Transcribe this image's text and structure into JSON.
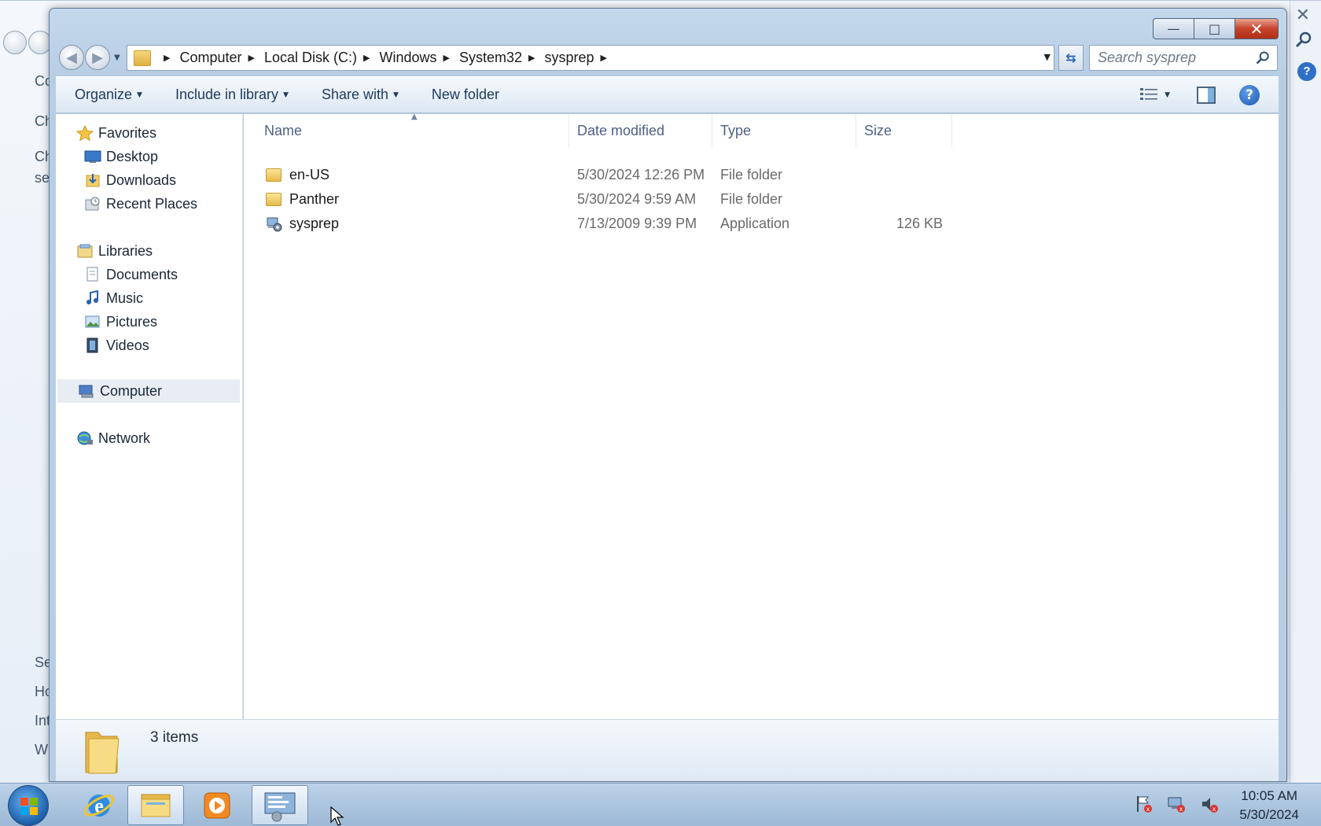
{
  "background_window": {
    "left_text_fragments": [
      "Co",
      "Ch",
      "Ch",
      "se",
      "Se",
      "Ho",
      "Int",
      "W"
    ]
  },
  "window": {
    "caption": {
      "minimize_glyph": "—",
      "maximize_glyph": "□",
      "close_glyph": "✕"
    },
    "nav": {
      "back_glyph": "◀",
      "forward_glyph": "▶"
    },
    "address": {
      "breadcrumbs": [
        "Computer",
        "Local Disk (C:)",
        "Windows",
        "System32",
        "sysprep"
      ]
    },
    "search": {
      "placeholder": "Search sysprep"
    },
    "toolbar": {
      "organize": "Organize",
      "include_in_library": "Include in library",
      "share_with": "Share with",
      "new_folder": "New folder"
    },
    "nav_pane": {
      "favorites": {
        "label": "Favorites",
        "items": [
          "Desktop",
          "Downloads",
          "Recent Places"
        ]
      },
      "libraries": {
        "label": "Libraries",
        "items": [
          "Documents",
          "Music",
          "Pictures",
          "Videos"
        ]
      },
      "computer": "Computer",
      "network": "Network"
    },
    "columns": {
      "name": "Name",
      "date_modified": "Date modified",
      "type": "Type",
      "size": "Size"
    },
    "files": [
      {
        "name": "en-US",
        "date_modified": "5/30/2024 12:26 PM",
        "type": "File folder",
        "size": "",
        "icon": "folder-icon"
      },
      {
        "name": "Panther",
        "date_modified": "5/30/2024 9:59 AM",
        "type": "File folder",
        "size": "",
        "icon": "folder-icon"
      },
      {
        "name": "sysprep",
        "date_modified": "7/13/2009 9:39 PM",
        "type": "Application",
        "size": "126 KB",
        "icon": "application-icon"
      }
    ],
    "details": {
      "item_count": "3 items"
    }
  },
  "taskbar": {
    "clock_time": "10:05 AM",
    "clock_date": "5/30/2024",
    "apps": [
      "internet-explorer-icon",
      "windows-explorer-icon",
      "media-player-icon",
      "system-properties-icon"
    ]
  }
}
